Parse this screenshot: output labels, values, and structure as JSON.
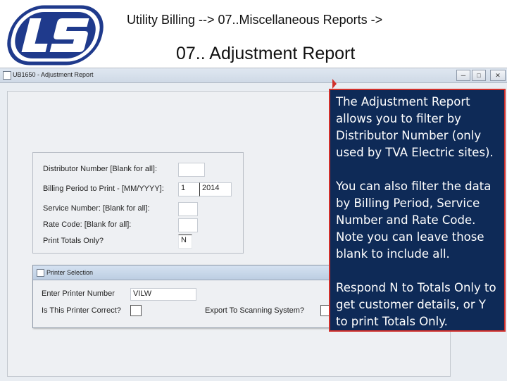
{
  "slide": {
    "breadcrumb": "Utility Billing -->   07..Miscellaneous Reports ->",
    "title": "07.. Adjustment Report"
  },
  "window": {
    "title": "UB1650 - Adjustment Report",
    "controls": {
      "minimize": "─",
      "maximize": "□",
      "close": "✕"
    }
  },
  "form": {
    "distributor_label": "Distributor Number [Blank for all]:",
    "distributor_value": "",
    "billing_period_label": "Billing Period to Print - [MM/YYYY]:",
    "billing_month": "1",
    "billing_year": "2014",
    "service_number_label": "Service Number:   [Blank for all]:",
    "service_number_value": "",
    "rate_code_label": "Rate Code:          [Blank for all]:",
    "rate_code_value": "",
    "print_totals_label": "Print Totals Only?",
    "print_totals_value": "N"
  },
  "printer_dialog": {
    "title": "Printer Selection",
    "enter_printer_label": "Enter Printer Number",
    "printer_value": "VILW",
    "printer_correct_label": "Is This Printer Correct?",
    "export_label": "Export To Scanning System?"
  },
  "callout": {
    "paragraph_1": "The Adjustment Report allows you to filter by Distributor Number (only used by TVA Electric sites).",
    "paragraph_2": "You can also filter the data by Billing Period, Service Number and Rate Code. Note you can leave those blank to include all.",
    "paragraph_3": "Respond N to Totals Only to get customer details, or Y  to print Totals Only."
  },
  "colors": {
    "logo_blue": "#1f3a8c",
    "callout_bg": "#0e2a57",
    "callout_border": "#d1302c"
  },
  "icons": {
    "logo": "ls-logo-icon",
    "pointer": "arrow-pointer-icon"
  }
}
